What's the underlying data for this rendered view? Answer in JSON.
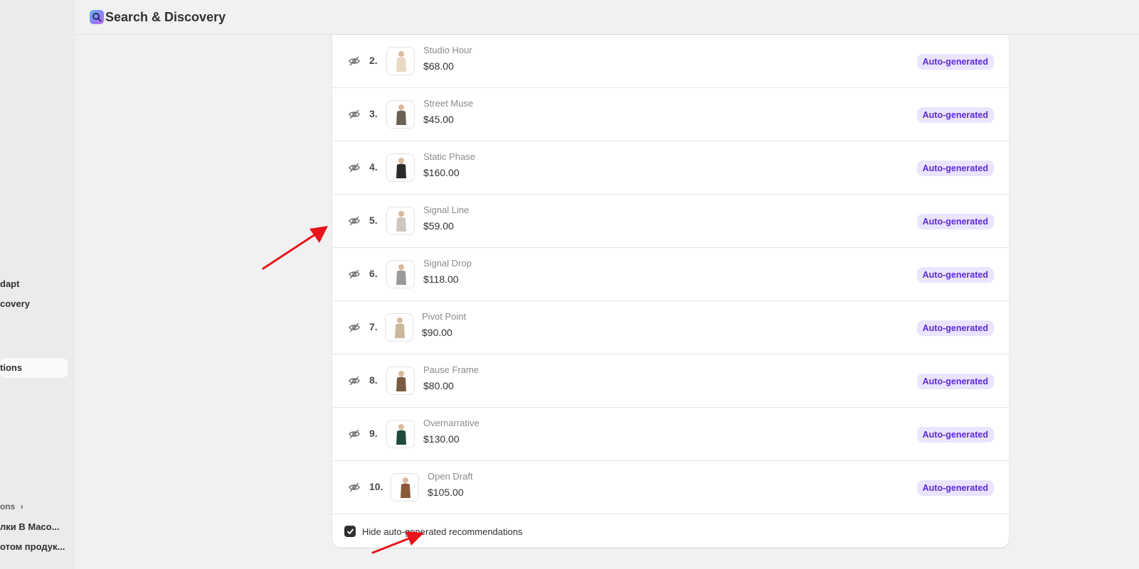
{
  "app": {
    "title": "Search & Discovery",
    "icon": "search-discovery-app-icon"
  },
  "sidebar": {
    "items": [
      {
        "label": "dapt"
      },
      {
        "label": "covery"
      },
      {
        "label": "tions"
      },
      {
        "label": "ons"
      },
      {
        "label": "лки В Maco..."
      },
      {
        "label": "отом продук..."
      }
    ]
  },
  "products": [
    {
      "rank": "2.",
      "name": "Studio Hour",
      "price": "$68.00",
      "badge": "Auto-generated",
      "thumb": "#e8d9c4"
    },
    {
      "rank": "3.",
      "name": "Street Muse",
      "price": "$45.00",
      "badge": "Auto-generated",
      "thumb": "#6b6256"
    },
    {
      "rank": "4.",
      "name": "Static Phase",
      "price": "$160.00",
      "badge": "Auto-generated",
      "thumb": "#2b2b2b"
    },
    {
      "rank": "5.",
      "name": "Signal Line",
      "price": "$59.00",
      "badge": "Auto-generated",
      "thumb": "#cfc8bd"
    },
    {
      "rank": "6.",
      "name": "Signal Drop",
      "price": "$118.00",
      "badge": "Auto-generated",
      "thumb": "#9a9a9a"
    },
    {
      "rank": "7.",
      "name": "Pivot Point",
      "price": "$90.00",
      "badge": "Auto-generated",
      "thumb": "#cbb79c"
    },
    {
      "rank": "8.",
      "name": "Pause Frame",
      "price": "$80.00",
      "badge": "Auto-generated",
      "thumb": "#7a5b42"
    },
    {
      "rank": "9.",
      "name": "Overnarrative",
      "price": "$130.00",
      "badge": "Auto-generated",
      "thumb": "#1f4a3e"
    },
    {
      "rank": "10.",
      "name": "Open Draft",
      "price": "$105.00",
      "badge": "Auto-generated",
      "thumb": "#8a5a38"
    }
  ],
  "footer": {
    "checkbox_label": "Hide auto-generated recommendations",
    "checked": true
  },
  "colors": {
    "badge_bg": "#eae4ff",
    "badge_text": "#5b2bd6",
    "annotation_arrow": "#e8141b"
  }
}
